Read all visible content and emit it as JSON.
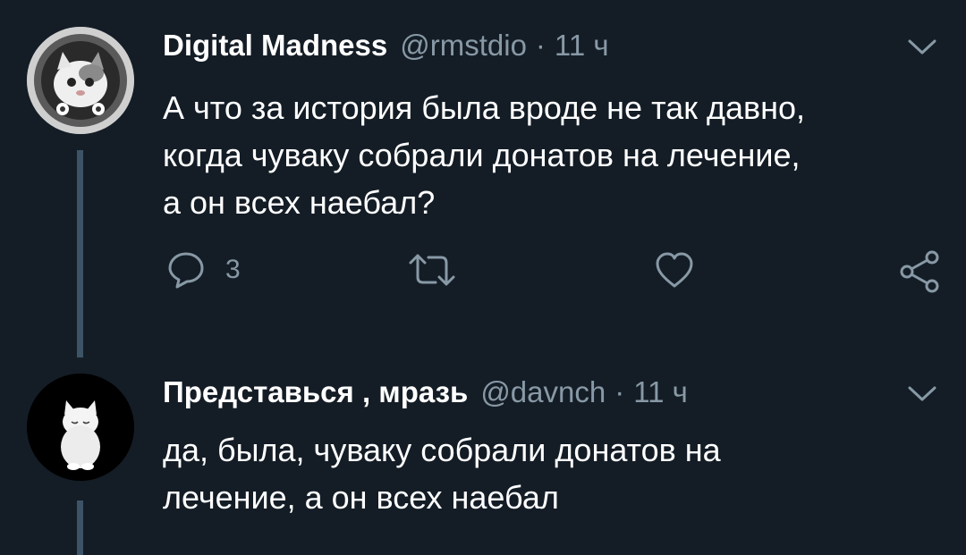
{
  "tweets": [
    {
      "author": "Digital Madness",
      "handle": "@rmstdio",
      "separator": "·",
      "time": "11 ч",
      "avatar_icon": "astronaut-cat-avatar",
      "text_lines": [
        "А что за история была вроде не так давно,",
        "когда чуваку собрали донатов на лечение,",
        "а он всех наебал?"
      ],
      "actions": {
        "reply_icon": "reply-icon",
        "reply_count": "3",
        "retweet_icon": "retweet-icon",
        "like_icon": "heart-icon",
        "share_icon": "share-icon"
      }
    },
    {
      "author": "Представься , мразь",
      "handle": "@davnch",
      "separator": "·",
      "time": "11 ч",
      "avatar_icon": "white-cat-avatar",
      "text_lines": [
        "да, была, чуваку собрали донатов на",
        "лечение, а он всех наебал"
      ]
    }
  ],
  "colors": {
    "background": "#141d26",
    "secondary_text": "#8899a6",
    "thread_line": "#3d5466"
  }
}
